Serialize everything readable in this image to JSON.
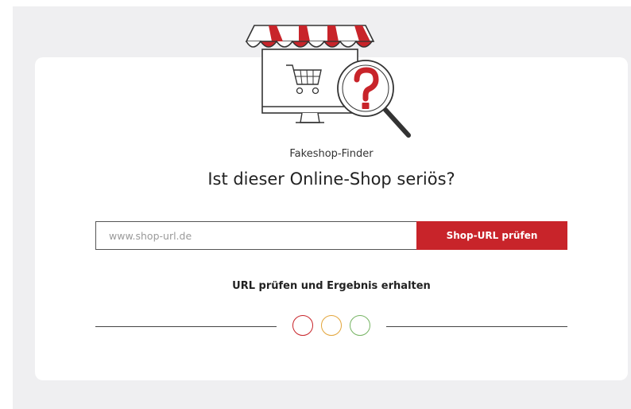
{
  "app": {
    "eyebrow": "Fakeshop-Finder",
    "headline": "Ist dieser Online-Shop seriös?"
  },
  "form": {
    "url_placeholder": "www.shop-url.de",
    "url_value": "",
    "submit_label": "Shop-URL prüfen"
  },
  "result": {
    "subheading": "URL prüfen und Ergebnis erhalten",
    "traffic_lights": [
      {
        "name": "red",
        "color": "#c8242a"
      },
      {
        "name": "yellow",
        "color": "#e3a53a"
      },
      {
        "name": "green",
        "color": "#76b463"
      }
    ]
  },
  "colors": {
    "brand_red": "#c8242a",
    "page_background": "#efeff1",
    "card_background": "#ffffff"
  },
  "icons": {
    "hero": "shop-with-magnifier-question-icon"
  }
}
